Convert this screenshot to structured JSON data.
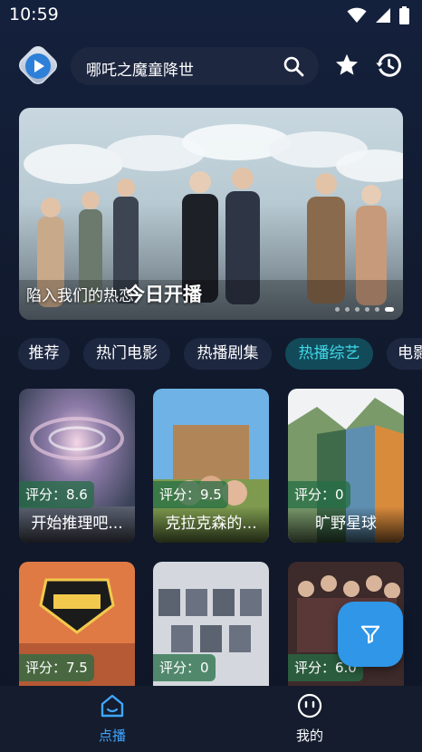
{
  "status_bar": {
    "time": "10:59"
  },
  "header": {
    "search_text": "哪吒之魔童降世",
    "icons": [
      "app-logo",
      "search-icon",
      "star-icon",
      "history-icon"
    ]
  },
  "banner": {
    "caption": "陷入我们的热恋",
    "headline": "今日开播",
    "page_count": 6,
    "active_index": 5
  },
  "tabs": [
    {
      "label": "推荐",
      "active": false
    },
    {
      "label": "热门电影",
      "active": false
    },
    {
      "label": "热播剧集",
      "active": false
    },
    {
      "label": "热播综艺",
      "active": true
    },
    {
      "label": "电影",
      "active": false
    }
  ],
  "cards": [
    {
      "score": "评分：8.6",
      "title": "开始推理吧..."
    },
    {
      "score": "评分：9.5",
      "title": "克拉克森的..."
    },
    {
      "score": "评分：0",
      "title": "旷野星球"
    },
    {
      "score": "评分：7.5",
      "title": ""
    },
    {
      "score": "评分：0",
      "title": ""
    },
    {
      "score": "评分：6.0",
      "title": ""
    }
  ],
  "bottom_nav": [
    {
      "label": "点播",
      "icon": "home-icon",
      "active": true
    },
    {
      "label": "我的",
      "icon": "smiley-icon",
      "active": false
    }
  ],
  "colors": {
    "accent_teal": "#40d9e8",
    "accent_blue": "#3fa6ff",
    "fab_blue": "#2f96e8",
    "background": "#111a2e"
  }
}
